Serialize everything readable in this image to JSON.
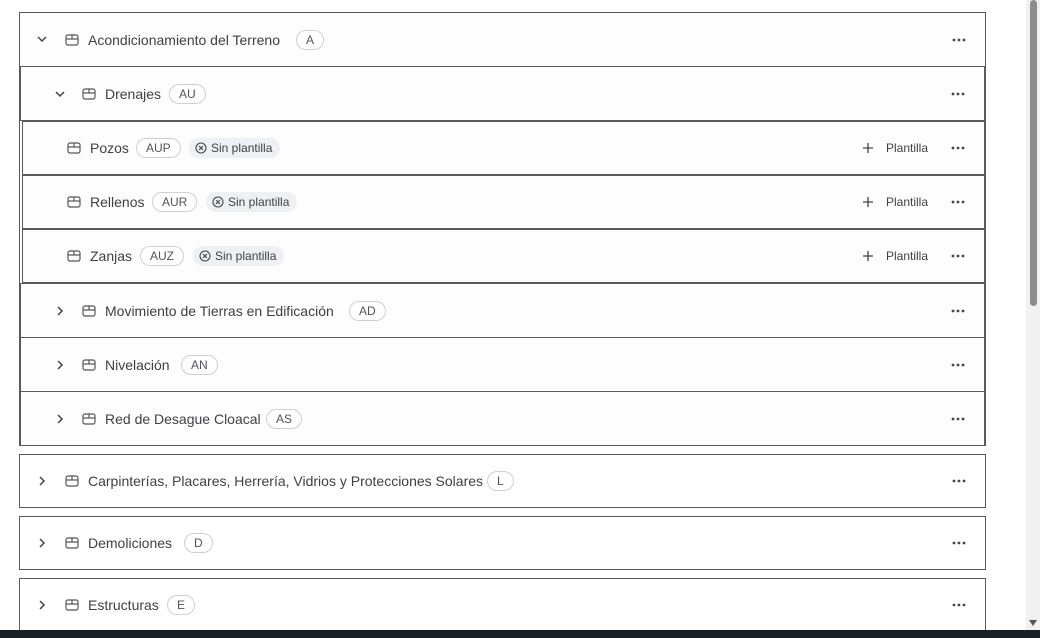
{
  "groups": [
    {
      "label": "Acondicionamiento del Terreno",
      "code": "A",
      "expanded": true,
      "children": [
        {
          "label": "Drenajes",
          "code": "AU",
          "expanded": true,
          "children": [
            {
              "label": "Pozos",
              "code": "AUP",
              "status": "Sin plantilla",
              "action": "Plantilla"
            },
            {
              "label": "Rellenos",
              "code": "AUR",
              "status": "Sin plantilla",
              "action": "Plantilla"
            },
            {
              "label": "Zanjas",
              "code": "AUZ",
              "status": "Sin plantilla",
              "action": "Plantilla"
            }
          ]
        },
        {
          "label": "Movimiento de Tierras en Edificación",
          "code": "AD",
          "expanded": false
        },
        {
          "label": "Nivelación",
          "code": "AN",
          "expanded": false
        },
        {
          "label": "Red de Desague Cloacal",
          "code": "AS",
          "expanded": false
        }
      ]
    },
    {
      "label": "Carpinterías, Placares, Herrería, Vidrios y Protecciones Solares",
      "code": "L",
      "expanded": false
    },
    {
      "label": "Demoliciones",
      "code": "D",
      "expanded": false
    },
    {
      "label": "Estructuras",
      "code": "E",
      "expanded": false
    }
  ],
  "icons": {
    "expand": "chevron-down-icon",
    "collapse": "chevron-right-icon",
    "category": "box-icon",
    "no_template": "circle-x-icon",
    "add": "plus-icon",
    "menu": "ellipsis-icon"
  }
}
